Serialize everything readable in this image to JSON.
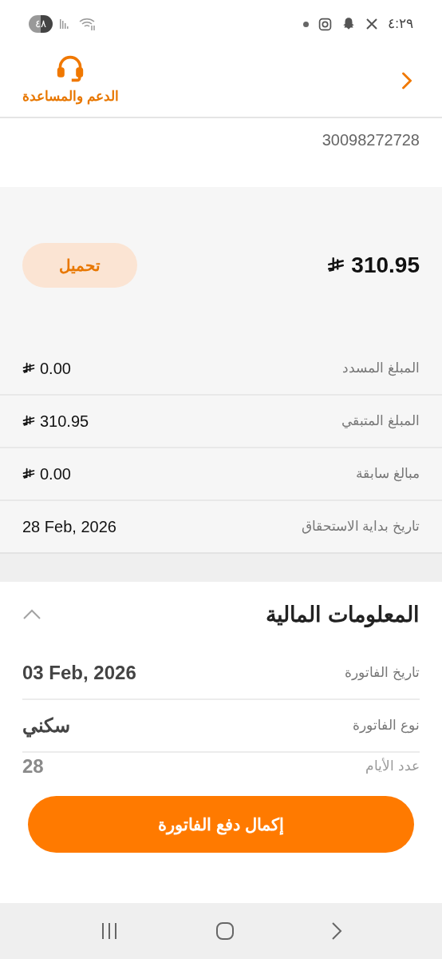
{
  "status_bar": {
    "time": "٤:٢٩",
    "battery": "٤٨"
  },
  "header": {
    "support_label": "الدعم والمساعدة"
  },
  "account_number": "30098272728",
  "total": {
    "amount": "310.95",
    "download_button": "تحميل"
  },
  "summary_rows": [
    {
      "label": "المبلغ المسدد",
      "value": "0.00",
      "kind": "amount"
    },
    {
      "label": "المبلغ المتبقي",
      "value": "310.95",
      "kind": "amount"
    },
    {
      "label": "مبالغ سابقة",
      "value": "0.00",
      "kind": "amount"
    },
    {
      "label": "تاريخ بداية الاستحقاق",
      "value": "28 Feb, 2026",
      "kind": "date"
    }
  ],
  "financial_info": {
    "title": "المعلومات المالية",
    "expanded": true,
    "rows": [
      {
        "label": "تاريخ الفاتورة",
        "value": "03 Feb, 2026",
        "kind": "full"
      },
      {
        "label": "نوع الفاتورة",
        "value": "سكني",
        "kind": "full"
      },
      {
        "label": "عدد الأيام",
        "value": "28",
        "kind": "cut"
      }
    ]
  },
  "pay_button": "إكمال دفع الفاتورة"
}
